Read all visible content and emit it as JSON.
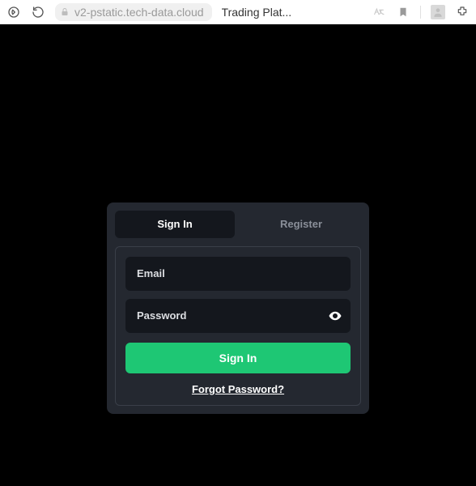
{
  "browser": {
    "url": "v2-pstatic.tech-data.cloud",
    "tab_title": "Trading Plat..."
  },
  "login": {
    "tabs": {
      "signin": "Sign In",
      "register": "Register"
    },
    "email_placeholder": "Email",
    "password_placeholder": "Password",
    "submit_label": "Sign In",
    "forgot_label": "Forgot Password?"
  }
}
